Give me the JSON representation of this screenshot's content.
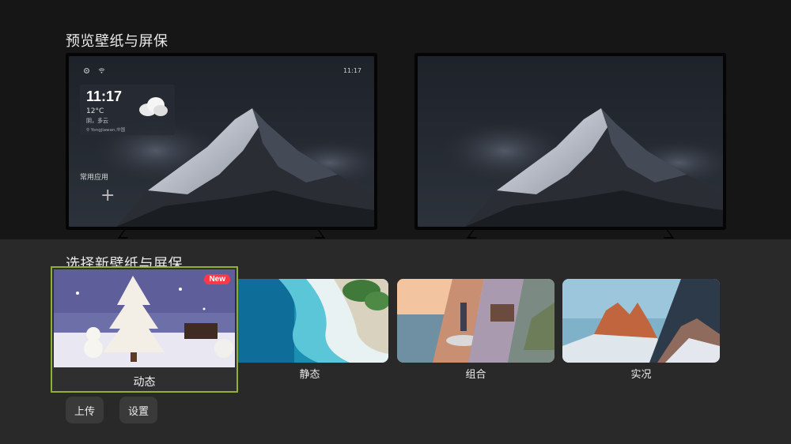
{
  "preview": {
    "title": "预览壁纸与屏保",
    "tv1": {
      "clock": "11:17",
      "widget": {
        "time": "11:17",
        "temp": "12°C",
        "condition": "阴，多云",
        "location": "Yongjiawan,中国"
      },
      "apps_label": "常用应用",
      "add_symbol": "+"
    }
  },
  "select": {
    "title": "选择新壁纸与屏保",
    "cards": [
      {
        "label": "动态",
        "badge": "New"
      },
      {
        "label": "静态"
      },
      {
        "label": "组合"
      },
      {
        "label": "实况"
      }
    ]
  },
  "buttons": {
    "upload": "上传",
    "settings": "设置"
  },
  "icons": [
    "settings-icon",
    "wifi-icon",
    "location-pin-icon",
    "cloud-icon",
    "plus-icon"
  ],
  "colors": {
    "focus_border": "#8fb033",
    "badge": "#ff3848"
  }
}
